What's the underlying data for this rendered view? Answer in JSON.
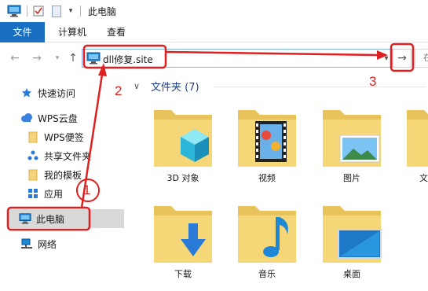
{
  "window": {
    "title": "此电脑"
  },
  "quick_access_icons": [
    "computer-icon",
    "checkbox-icon",
    "blank-doc-icon",
    "dropdown-arrow-icon"
  ],
  "ribbon": {
    "tabs": [
      {
        "label": "文件",
        "active": true
      },
      {
        "label": "计算机",
        "active": false
      },
      {
        "label": "查看",
        "active": false
      }
    ]
  },
  "address": {
    "path": "dll修复.site",
    "search_text": "在"
  },
  "sidebar": {
    "items": [
      {
        "label": "快速访问",
        "icon": "star-icon"
      },
      {
        "label": "WPS云盘",
        "icon": "cloud-icon"
      },
      {
        "label": "WPS便签",
        "icon": "folder-icon"
      },
      {
        "label": "共享文件夹",
        "icon": "share-icon"
      },
      {
        "label": "我的模板",
        "icon": "folder-icon"
      },
      {
        "label": "应用",
        "icon": "apps-icon"
      },
      {
        "label": "此电脑",
        "icon": "computer-icon",
        "selected": true
      },
      {
        "label": "网络",
        "icon": "network-icon"
      }
    ]
  },
  "main": {
    "group_title": "文件夹 (7)",
    "folders": [
      {
        "label": "3D 对象",
        "icon": "3d-objects-icon"
      },
      {
        "label": "视频",
        "icon": "video-icon"
      },
      {
        "label": "图片",
        "icon": "pictures-icon"
      },
      {
        "label": "文",
        "icon": "documents-icon"
      },
      {
        "label": "下载",
        "icon": "download-icon"
      },
      {
        "label": "音乐",
        "icon": "music-icon"
      },
      {
        "label": "桌面",
        "icon": "desktop-icon"
      }
    ]
  },
  "annotations": {
    "numbers": [
      "1",
      "2",
      "3"
    ],
    "color": "#e02020"
  }
}
